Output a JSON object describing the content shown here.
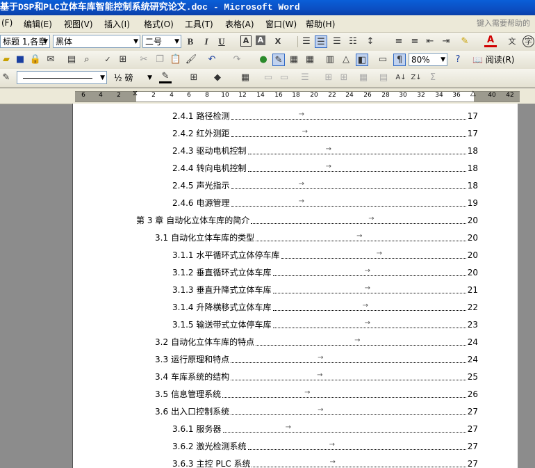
{
  "window": {
    "title": "基于DSP和PLC立体车库智能控制系统研究论文.doc - Microsoft Word"
  },
  "menu": {
    "items": [
      "(F)",
      "编辑(E)",
      "视图(V)",
      "插入(I)",
      "格式(O)",
      "工具(T)",
      "表格(A)",
      "窗口(W)",
      "帮助(H)"
    ],
    "help_placeholder": "键入需要帮助的"
  },
  "format_toolbar": {
    "style": "标题 1,各章",
    "font": "黑体",
    "size": "二号"
  },
  "standard_toolbar": {
    "zoom": "80%",
    "read_label": "阅读(R)"
  },
  "drawing_toolbar": {
    "line_weight": "½ 磅"
  },
  "ruler": {
    "numbers": [
      "6",
      "4",
      "2",
      "2",
      "4",
      "6",
      "8",
      "10",
      "12",
      "14",
      "16",
      "18",
      "20",
      "22",
      "24",
      "26",
      "28",
      "30",
      "32",
      "34",
      "36",
      "40",
      "42"
    ]
  },
  "toc": [
    {
      "level": 3,
      "num": "2.4.1",
      "title": "路径检测",
      "page": "17"
    },
    {
      "level": 3,
      "num": "2.4.2",
      "title": "红外测距",
      "page": "17"
    },
    {
      "level": 3,
      "num": "2.4.3",
      "title": "驱动电机控制",
      "page": "18"
    },
    {
      "level": 3,
      "num": "2.4.4",
      "title": "转向电机控制",
      "page": "18"
    },
    {
      "level": 3,
      "num": "2.4.5",
      "title": "声光指示",
      "page": "18"
    },
    {
      "level": 3,
      "num": "2.4.6",
      "title": "电源管理",
      "page": "19"
    },
    {
      "level": 1,
      "num": "第 3 章",
      "title": "自动化立体车库的简介",
      "page": "20"
    },
    {
      "level": 2,
      "num": "3.1",
      "title": "自动化立体车库的类型",
      "page": "20"
    },
    {
      "level": 3,
      "num": "3.1.1",
      "title": "水平循环式立体停车库",
      "page": "20"
    },
    {
      "level": 3,
      "num": "3.1.2",
      "title": "垂直循环式立体车库",
      "page": "20"
    },
    {
      "level": 3,
      "num": "3.1.3",
      "title": "垂直升降式立体车库",
      "page": "21"
    },
    {
      "level": 3,
      "num": "3.1.4",
      "title": "升降横移式立体车库",
      "page": "22"
    },
    {
      "level": 3,
      "num": "3.1.5",
      "title": "输送带式立体停车库",
      "page": "23"
    },
    {
      "level": 2,
      "num": "3.2",
      "title": "自动化立体车库的特点",
      "page": "24"
    },
    {
      "level": 2,
      "num": "3.3",
      "title": "运行原理和特点",
      "page": "24"
    },
    {
      "level": 2,
      "num": "3.4",
      "title": "车库系统的结构",
      "page": "25"
    },
    {
      "level": 2,
      "num": "3.5",
      "title": "信息管理系统",
      "page": "26"
    },
    {
      "level": 2,
      "num": "3.6",
      "title": "出入口控制系统",
      "page": "27"
    },
    {
      "level": 3,
      "num": "3.6.1",
      "title": "服务器",
      "page": "27"
    },
    {
      "level": 3,
      "num": "3.6.2",
      "title": "激光检测系统",
      "page": "27"
    },
    {
      "level": 3,
      "num": "3.6.3",
      "title": "主控 PLC 系统",
      "page": "27"
    }
  ],
  "colors": {
    "titlebar": "#0b4ec2",
    "page": "#ffffff",
    "workspace": "#8c8c8c",
    "toolbar": "#ece9d8"
  }
}
